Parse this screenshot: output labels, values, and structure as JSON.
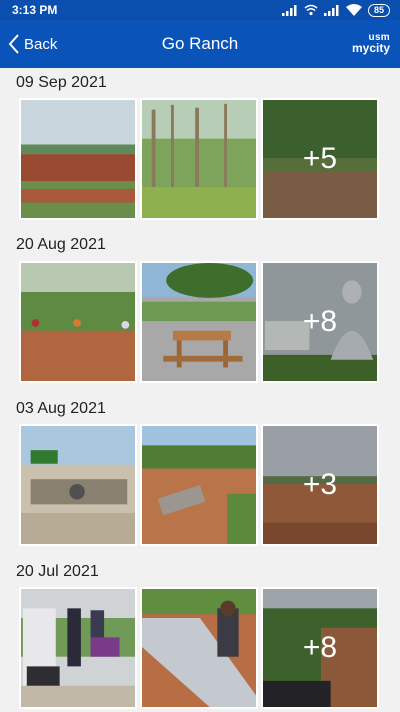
{
  "status": {
    "time": "3:13 PM",
    "battery": "85"
  },
  "header": {
    "back_label": "Back",
    "title": "Go Ranch",
    "brand_top": "usm",
    "brand_bottom": "mycity"
  },
  "albums": [
    {
      "date": "09 Sep 2021",
      "more_count": "+5"
    },
    {
      "date": "20 Aug 2021",
      "more_count": "+8"
    },
    {
      "date": "03 Aug 2021",
      "more_count": "+3"
    },
    {
      "date": "20 Jul 2021",
      "more_count": "+8"
    }
  ],
  "colors": {
    "app_bar": "#0a53b8",
    "status_bar": "#0a4fae",
    "background": "#f1f1f1"
  }
}
